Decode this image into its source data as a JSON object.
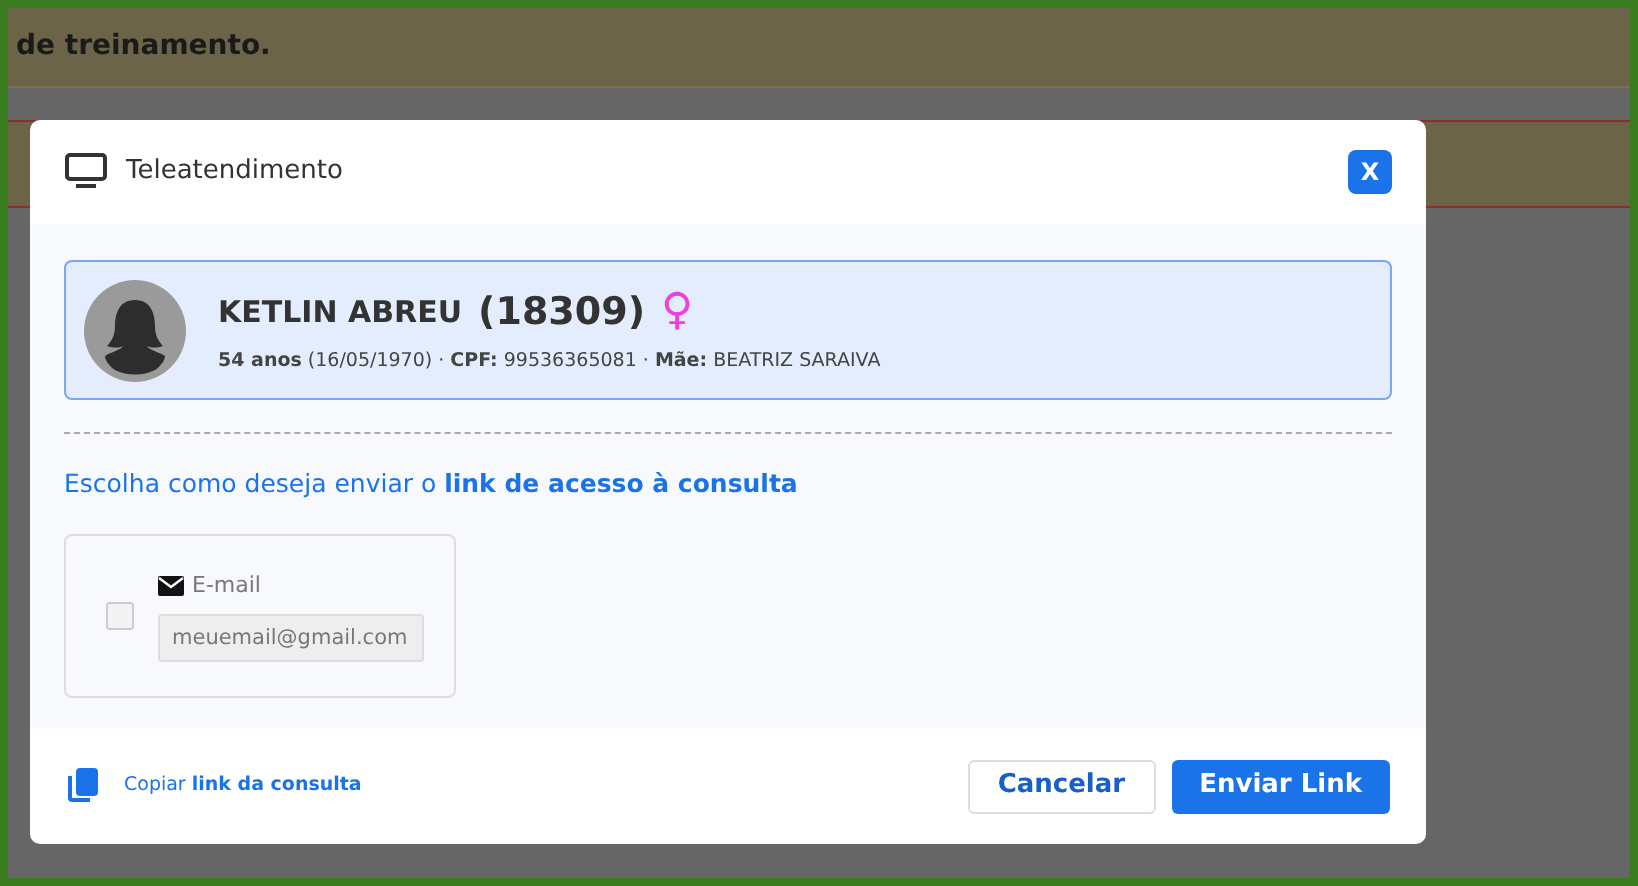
{
  "background": {
    "banner": "de treinamento."
  },
  "modal": {
    "title": "Teleatendimento",
    "close": "X",
    "patient": {
      "name": "KETLIN ABREU",
      "id": "(18309)",
      "gender_symbol": "♀",
      "details": "**54 anos** (16/05/1970) · **CPF:** 99536365081 · **Mãe:** BEATRIZ SARAIVA"
    },
    "instruction": "Escolha como deseja enviar o **link de acesso à consulta**",
    "options": [
      {
        "kind": "email",
        "label": "E-mail",
        "checked": false,
        "placeholder": "meuemail@gmail.com"
      }
    ],
    "copy_link": "Copiar **link da consulta**",
    "buttons": [
      {
        "label": "Cancelar",
        "kind": "secondary"
      },
      {
        "label": "Enviar Link",
        "kind": "primary"
      }
    ]
  }
}
